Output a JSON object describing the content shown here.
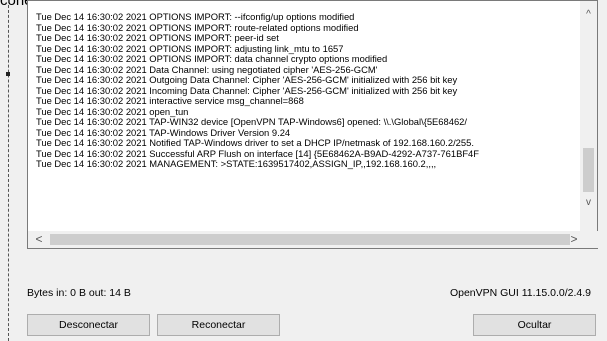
{
  "window": {
    "title_fragment": "conexión"
  },
  "log": {
    "lines": [
      "Tue Dec 14 16:30:02 2021 OPTIONS IMPORT: --ifconfig/up options modified",
      "Tue Dec 14 16:30:02 2021 OPTIONS IMPORT: route-related options modified",
      "Tue Dec 14 16:30:02 2021 OPTIONS IMPORT: peer-id set",
      "Tue Dec 14 16:30:02 2021 OPTIONS IMPORT: adjusting link_mtu to 1657",
      "Tue Dec 14 16:30:02 2021 OPTIONS IMPORT: data channel crypto options modified",
      "Tue Dec 14 16:30:02 2021 Data Channel: using negotiated cipher 'AES-256-GCM'",
      "Tue Dec 14 16:30:02 2021 Outgoing Data Channel: Cipher 'AES-256-GCM' initialized with 256 bit key",
      "Tue Dec 14 16:30:02 2021 Incoming Data Channel: Cipher 'AES-256-GCM' initialized with 256 bit key",
      "Tue Dec 14 16:30:02 2021 interactive service msg_channel=868",
      "Tue Dec 14 16:30:02 2021 open_tun",
      "Tue Dec 14 16:30:02 2021 TAP-WIN32 device [OpenVPN TAP-Windows6] opened: \\\\.\\Global\\{5E68462/",
      "Tue Dec 14 16:30:02 2021 TAP-Windows Driver Version 9.24",
      "Tue Dec 14 16:30:02 2021 Notified TAP-Windows driver to set a DHCP IP/netmask of 192.168.160.2/255.",
      "Tue Dec 14 16:30:02 2021 Successful ARP Flush on interface [14] {5E68462A-B9AD-4292-A737-761BF4F",
      "Tue Dec 14 16:30:02 2021 MANAGEMENT: >STATE:1639517402,ASSIGN_IP,,192.168.160.2,,,,"
    ],
    "scroll_up_glyph": "^",
    "scroll_down_glyph": "v",
    "scroll_left_glyph": "<",
    "scroll_right_glyph": ">"
  },
  "status": {
    "bytes": "Bytes in: 0 B  out: 14 B",
    "version": "OpenVPN GUI 11.15.0.0/2.4.9"
  },
  "buttons": {
    "disconnect": "Desconectar",
    "reconnect": "Reconectar",
    "hide": "Ocultar"
  },
  "icons": {
    "scroll_up": "chevron-up-icon",
    "scroll_down": "chevron-down-icon",
    "scroll_left": "chevron-left-icon",
    "scroll_right": "chevron-right-icon"
  }
}
